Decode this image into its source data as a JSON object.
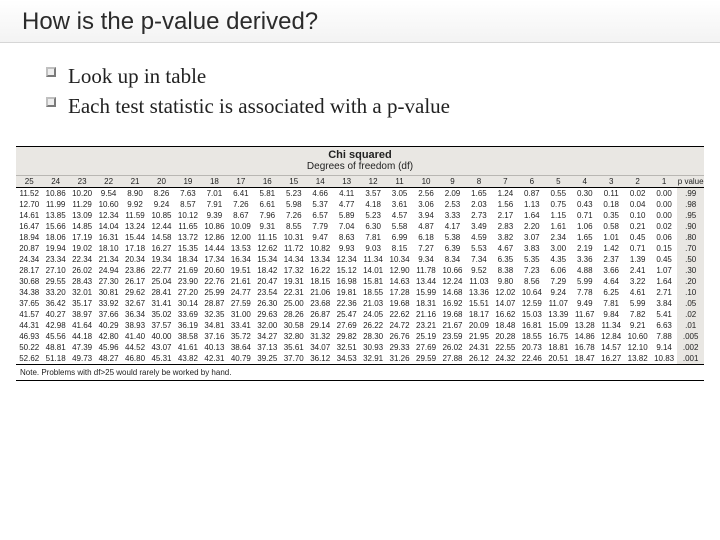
{
  "title": "How is the p-value derived?",
  "bullets": [
    "Look up in table",
    "Each test statistic is associated with a p-value"
  ],
  "chi_table": {
    "title": "Chi squared",
    "subtitle": "Degrees of freedom (df)",
    "df_headers": [
      "25",
      "24",
      "23",
      "22",
      "21",
      "20",
      "19",
      "18",
      "17",
      "16",
      "15",
      "14",
      "13",
      "12",
      "11",
      "10",
      "9",
      "8",
      "7",
      "6",
      "5",
      "4",
      "3",
      "2",
      "1"
    ],
    "pvalue_header": "p value",
    "rows": [
      {
        "p": ".99",
        "v": [
          "11.52",
          "10.86",
          "10.20",
          "9.54",
          "8.90",
          "8.26",
          "7.63",
          "7.01",
          "6.41",
          "5.81",
          "5.23",
          "4.66",
          "4.11",
          "3.57",
          "3.05",
          "2.56",
          "2.09",
          "1.65",
          "1.24",
          "0.87",
          "0.55",
          "0.30",
          "0.11",
          "0.02",
          "0.00"
        ]
      },
      {
        "p": ".98",
        "v": [
          "12.70",
          "11.99",
          "11.29",
          "10.60",
          "9.92",
          "9.24",
          "8.57",
          "7.91",
          "7.26",
          "6.61",
          "5.98",
          "5.37",
          "4.77",
          "4.18",
          "3.61",
          "3.06",
          "2.53",
          "2.03",
          "1.56",
          "1.13",
          "0.75",
          "0.43",
          "0.18",
          "0.04",
          "0.00"
        ]
      },
      {
        "p": ".95",
        "v": [
          "14.61",
          "13.85",
          "13.09",
          "12.34",
          "11.59",
          "10.85",
          "10.12",
          "9.39",
          "8.67",
          "7.96",
          "7.26",
          "6.57",
          "5.89",
          "5.23",
          "4.57",
          "3.94",
          "3.33",
          "2.73",
          "2.17",
          "1.64",
          "1.15",
          "0.71",
          "0.35",
          "0.10",
          "0.00"
        ]
      },
      {
        "p": ".90",
        "v": [
          "16.47",
          "15.66",
          "14.85",
          "14.04",
          "13.24",
          "12.44",
          "11.65",
          "10.86",
          "10.09",
          "9.31",
          "8.55",
          "7.79",
          "7.04",
          "6.30",
          "5.58",
          "4.87",
          "4.17",
          "3.49",
          "2.83",
          "2.20",
          "1.61",
          "1.06",
          "0.58",
          "0.21",
          "0.02"
        ]
      },
      {
        "p": ".80",
        "v": [
          "18.94",
          "18.06",
          "17.19",
          "16.31",
          "15.44",
          "14.58",
          "13.72",
          "12.86",
          "12.00",
          "11.15",
          "10.31",
          "9.47",
          "8.63",
          "7.81",
          "6.99",
          "6.18",
          "5.38",
          "4.59",
          "3.82",
          "3.07",
          "2.34",
          "1.65",
          "1.01",
          "0.45",
          "0.06"
        ]
      },
      {
        "p": ".70",
        "v": [
          "20.87",
          "19.94",
          "19.02",
          "18.10",
          "17.18",
          "16.27",
          "15.35",
          "14.44",
          "13.53",
          "12.62",
          "11.72",
          "10.82",
          "9.93",
          "9.03",
          "8.15",
          "7.27",
          "6.39",
          "5.53",
          "4.67",
          "3.83",
          "3.00",
          "2.19",
          "1.42",
          "0.71",
          "0.15"
        ]
      },
      {
        "p": ".50",
        "v": [
          "24.34",
          "23.34",
          "22.34",
          "21.34",
          "20.34",
          "19.34",
          "18.34",
          "17.34",
          "16.34",
          "15.34",
          "14.34",
          "13.34",
          "12.34",
          "11.34",
          "10.34",
          "9.34",
          "8.34",
          "7.34",
          "6.35",
          "5.35",
          "4.35",
          "3.36",
          "2.37",
          "1.39",
          "0.45"
        ]
      },
      {
        "p": ".30",
        "v": [
          "28.17",
          "27.10",
          "26.02",
          "24.94",
          "23.86",
          "22.77",
          "21.69",
          "20.60",
          "19.51",
          "18.42",
          "17.32",
          "16.22",
          "15.12",
          "14.01",
          "12.90",
          "11.78",
          "10.66",
          "9.52",
          "8.38",
          "7.23",
          "6.06",
          "4.88",
          "3.66",
          "2.41",
          "1.07"
        ]
      },
      {
        "p": ".20",
        "v": [
          "30.68",
          "29.55",
          "28.43",
          "27.30",
          "26.17",
          "25.04",
          "23.90",
          "22.76",
          "21.61",
          "20.47",
          "19.31",
          "18.15",
          "16.98",
          "15.81",
          "14.63",
          "13.44",
          "12.24",
          "11.03",
          "9.80",
          "8.56",
          "7.29",
          "5.99",
          "4.64",
          "3.22",
          "1.64"
        ]
      },
      {
        "p": ".10",
        "v": [
          "34.38",
          "33.20",
          "32.01",
          "30.81",
          "29.62",
          "28.41",
          "27.20",
          "25.99",
          "24.77",
          "23.54",
          "22.31",
          "21.06",
          "19.81",
          "18.55",
          "17.28",
          "15.99",
          "14.68",
          "13.36",
          "12.02",
          "10.64",
          "9.24",
          "7.78",
          "6.25",
          "4.61",
          "2.71"
        ]
      },
      {
        "p": ".05",
        "v": [
          "37.65",
          "36.42",
          "35.17",
          "33.92",
          "32.67",
          "31.41",
          "30.14",
          "28.87",
          "27.59",
          "26.30",
          "25.00",
          "23.68",
          "22.36",
          "21.03",
          "19.68",
          "18.31",
          "16.92",
          "15.51",
          "14.07",
          "12.59",
          "11.07",
          "9.49",
          "7.81",
          "5.99",
          "3.84"
        ]
      },
      {
        "p": ".02",
        "v": [
          "41.57",
          "40.27",
          "38.97",
          "37.66",
          "36.34",
          "35.02",
          "33.69",
          "32.35",
          "31.00",
          "29.63",
          "28.26",
          "26.87",
          "25.47",
          "24.05",
          "22.62",
          "21.16",
          "19.68",
          "18.17",
          "16.62",
          "15.03",
          "13.39",
          "11.67",
          "9.84",
          "7.82",
          "5.41"
        ]
      },
      {
        "p": ".01",
        "v": [
          "44.31",
          "42.98",
          "41.64",
          "40.29",
          "38.93",
          "37.57",
          "36.19",
          "34.81",
          "33.41",
          "32.00",
          "30.58",
          "29.14",
          "27.69",
          "26.22",
          "24.72",
          "23.21",
          "21.67",
          "20.09",
          "18.48",
          "16.81",
          "15.09",
          "13.28",
          "11.34",
          "9.21",
          "6.63"
        ]
      },
      {
        "p": ".005",
        "v": [
          "46.93",
          "45.56",
          "44.18",
          "42.80",
          "41.40",
          "40.00",
          "38.58",
          "37.16",
          "35.72",
          "34.27",
          "32.80",
          "31.32",
          "29.82",
          "28.30",
          "26.76",
          "25.19",
          "23.59",
          "21.95",
          "20.28",
          "18.55",
          "16.75",
          "14.86",
          "12.84",
          "10.60",
          "7.88"
        ]
      },
      {
        "p": ".002",
        "v": [
          "50.22",
          "48.81",
          "47.39",
          "45.96",
          "44.52",
          "43.07",
          "41.61",
          "40.13",
          "38.64",
          "37.13",
          "35.61",
          "34.07",
          "32.51",
          "30.93",
          "29.33",
          "27.69",
          "26.02",
          "24.31",
          "22.55",
          "20.73",
          "18.81",
          "16.78",
          "14.57",
          "12.10",
          "9.14"
        ]
      },
      {
        "p": ".001",
        "v": [
          "52.62",
          "51.18",
          "49.73",
          "48.27",
          "46.80",
          "45.31",
          "43.82",
          "42.31",
          "40.79",
          "39.25",
          "37.70",
          "36.12",
          "34.53",
          "32.91",
          "31.26",
          "29.59",
          "27.88",
          "26.12",
          "24.32",
          "22.46",
          "20.51",
          "18.47",
          "16.27",
          "13.82",
          "10.83"
        ]
      }
    ],
    "note": "Note. Problems with df>25 would rarely be worked by hand."
  }
}
